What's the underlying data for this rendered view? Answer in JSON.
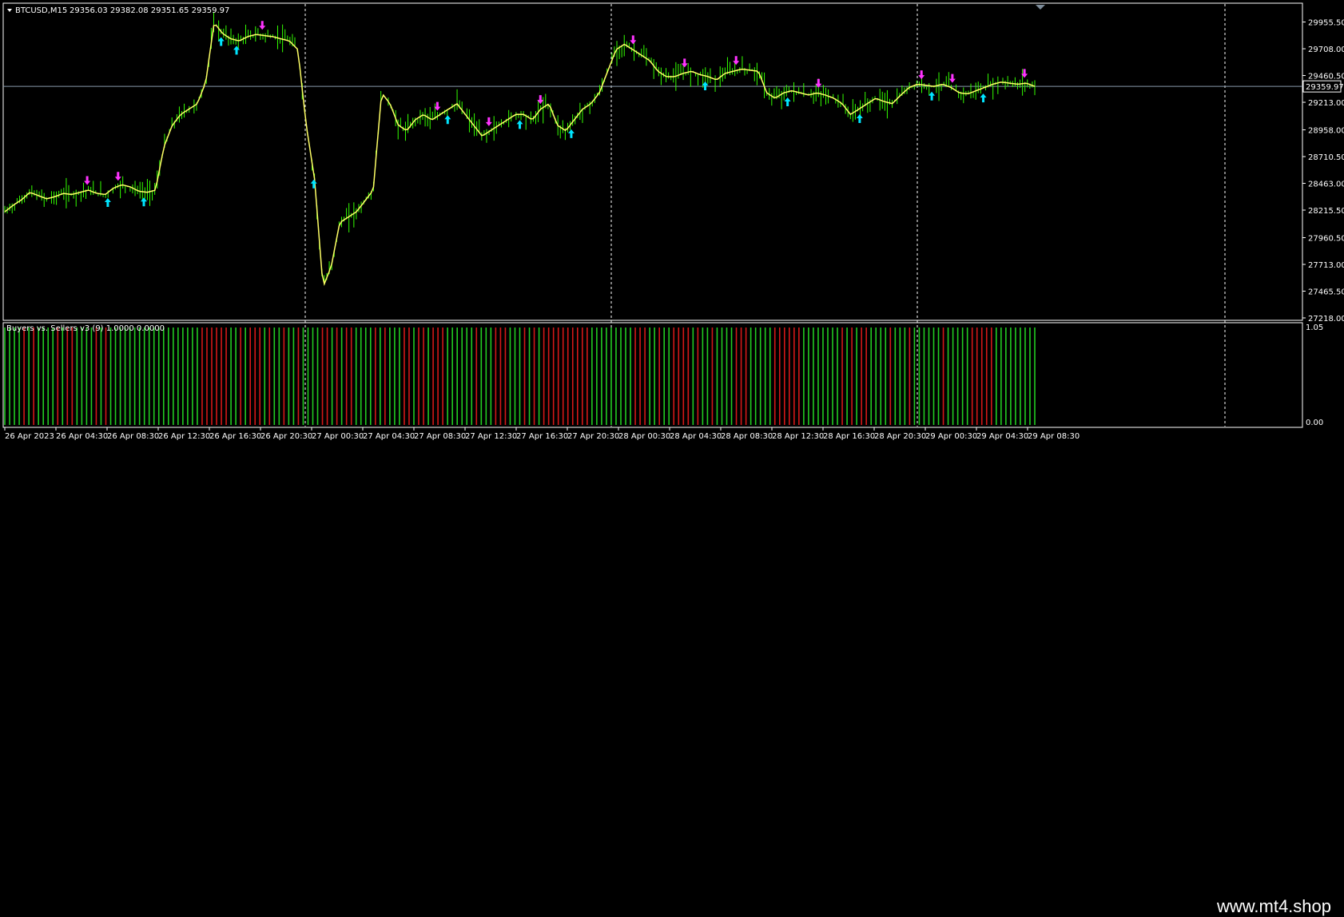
{
  "window": {
    "title": "BTCUSD,M15",
    "ohlc": "29356.03 29382.08 29351.65 29359.97",
    "indicator_title": "Buyers vs. Sellers v3 (9) 1.0000 0.0000",
    "watermark": "www.mt4.shop"
  },
  "colors": {
    "background": "#000000",
    "candle": "#33ff00",
    "ma": "#ffff66",
    "buy_arrow": "#00e5ff",
    "sell_arrow": "#ff33ff",
    "buyers_bar": "#22cc22",
    "sellers_bar": "#d41818",
    "price_line": "#8899aa",
    "grid_sep": "#ffffff"
  },
  "chart_data": [
    {
      "type": "line",
      "series": [
        {
          "values": [
            28200,
            28260,
            28310,
            28380,
            28350,
            28320,
            28340,
            28370,
            28360,
            28380,
            28400,
            28370,
            28360,
            28420,
            28450,
            28430,
            28390,
            28380,
            28400,
            28800,
            29000,
            29100,
            29150,
            29200,
            29400,
            29950,
            29850,
            29800,
            29780,
            29820,
            29840,
            29830,
            29820,
            29800,
            29780,
            29700,
            29000,
            28500,
            27500,
            27700,
            28100,
            28150,
            28200,
            28300,
            28400,
            29300,
            29200,
            29000,
            28950,
            29050,
            29100,
            29050,
            29100,
            29150,
            29200,
            29100,
            29000,
            28900,
            28950,
            29000,
            29050,
            29100,
            29100,
            29050,
            29150,
            29200,
            29000,
            28950,
            29050,
            29150,
            29200,
            29300,
            29500,
            29700,
            29750,
            29700,
            29650,
            29600,
            29500,
            29450,
            29450,
            29480,
            29500,
            29470,
            29450,
            29420,
            29480,
            29500,
            29520,
            29510,
            29500,
            29300,
            29250,
            29300,
            29320,
            29300,
            29280,
            29300,
            29280,
            29250,
            29200,
            29100,
            29150,
            29200,
            29250,
            29220,
            29200,
            29280,
            29350,
            29380,
            29370,
            29360,
            29380,
            29350,
            29300,
            29290,
            29320,
            29350,
            29380,
            29400,
            29390,
            29380,
            29390,
            29360
          ]
        }
      ],
      "ylim": [
        27218,
        30100
      ],
      "y_ticks": [
        "29955.50",
        "29708.00",
        "29460.50",
        "29213.00",
        "28958.00",
        "28710.50",
        "28463.00",
        "28215.50",
        "27960.50",
        "27713.00",
        "27465.50",
        "27218.00"
      ],
      "current_price": "29359.97",
      "x_ticks": [
        "26 Apr 2023",
        "26 Apr 04:30",
        "26 Apr 08:30",
        "26 Apr 12:30",
        "26 Apr 16:30",
        "26 Apr 20:30",
        "27 Apr 00:30",
        "27 Apr 04:30",
        "27 Apr 08:30",
        "27 Apr 12:30",
        "27 Apr 16:30",
        "27 Apr 20:30",
        "28 Apr 00:30",
        "28 Apr 04:30",
        "28 Apr 08:30",
        "28 Apr 12:30",
        "28 Apr 16:30",
        "28 Apr 20:30",
        "29 Apr 00:30",
        "29 Apr 04:30",
        "29 Apr 08:30"
      ]
    },
    {
      "type": "bar",
      "ylim": [
        0,
        1.05
      ],
      "y_ticks": [
        "1.05",
        "0.00"
      ],
      "buy_sell_pattern": "BBBBRBRBBBBRBRRBBBBRBRBBBBBBBBBBBBBBBBBBBRRRRRRBBRBRRRBRBBRBBRBBBBRRBRBRRBBBBRBRBBBRRBRRBRRRBBBBBBRBBBRRRBBBRBRBRRRRRRRRRRBBBBBBBBBRRRBBRBBRRRRBRBBRBBBBRRRBBBBBRRRRRRBBBBBBBBRBRBRRBBBBRBBBRBBBBBBRBBBBBRRRRRBBBBBBBBB"
    }
  ]
}
